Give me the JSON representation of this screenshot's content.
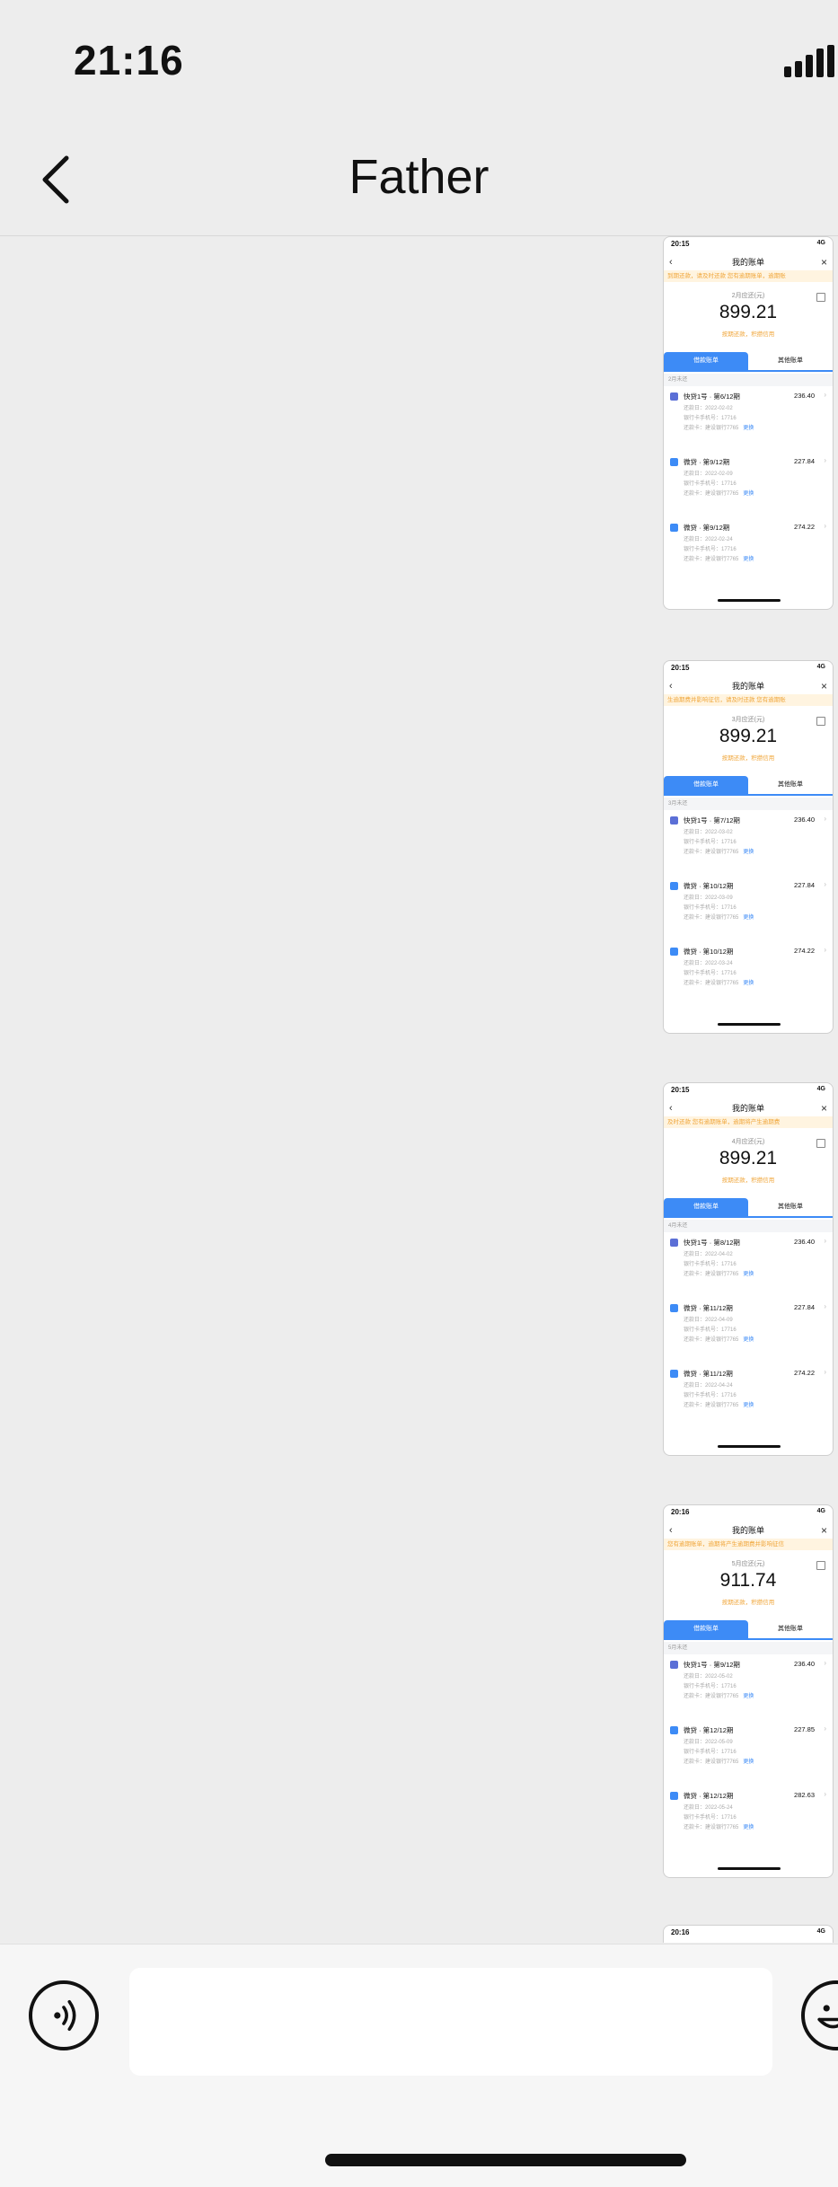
{
  "status_bar": {
    "time": "21:16"
  },
  "nav": {
    "title": "Father"
  },
  "screenshots": [
    {
      "time": "20:15",
      "net": "4G",
      "header": "我的账单",
      "banner": "到期还款，请及时还款     您有逾期账单，逾期账",
      "month": "2月应还(元)",
      "amount": "899.21",
      "hint": "按期还款，积攒信用",
      "tab_active": "借款账单",
      "tab_other": "其他账单",
      "section": "2月未还",
      "items": [
        {
          "name": "快贷1号 · 第6/12期",
          "amount": "236.40",
          "due": "还款日：2022-02-02",
          "bank": "银行卡手机号：17716",
          "card": "还款卡：建设银行7765",
          "link": "更换"
        },
        {
          "name": "微贷 · 第9/12期",
          "amount": "227.84",
          "due": "还款日：2022-02-09",
          "bank": "银行卡手机号：17716",
          "card": "还款卡：建设银行7765",
          "link": "更换"
        },
        {
          "name": "微贷 · 第9/12期",
          "amount": "274.22",
          "due": "还款日：2022-02-24",
          "bank": "银行卡手机号：17716",
          "card": "还款卡：建设银行7765",
          "link": "更换"
        }
      ]
    },
    {
      "time": "20:15",
      "net": "4G",
      "header": "我的账单",
      "banner": "生逾期费并影响征信，请及时还款     您有逾期账",
      "month": "3月应还(元)",
      "amount": "899.21",
      "hint": "按期还款，积攒信用",
      "tab_active": "借款账单",
      "tab_other": "其他账单",
      "section": "3月未还",
      "items": [
        {
          "name": "快贷1号 · 第7/12期",
          "amount": "236.40",
          "due": "还款日：2022-03-02",
          "bank": "银行卡手机号：17716",
          "card": "还款卡：建设银行7765",
          "link": "更换"
        },
        {
          "name": "微贷 · 第10/12期",
          "amount": "227.84",
          "due": "还款日：2022-03-09",
          "bank": "银行卡手机号：17716",
          "card": "还款卡：建设银行7765",
          "link": "更换"
        },
        {
          "name": "微贷 · 第10/12期",
          "amount": "274.22",
          "due": "还款日：2022-03-24",
          "bank": "银行卡手机号：17716",
          "card": "还款卡：建设银行7765",
          "link": "更换"
        }
      ]
    },
    {
      "time": "20:15",
      "net": "4G",
      "header": "我的账单",
      "banner": "及时还款     您有逾期账单，逾期将产生逾期费",
      "month": "4月应还(元)",
      "amount": "899.21",
      "hint": "按期还款，积攒信用",
      "tab_active": "借款账单",
      "tab_other": "其他账单",
      "section": "4月未还",
      "items": [
        {
          "name": "快贷1号 · 第8/12期",
          "amount": "236.40",
          "due": "还款日：2022-04-02",
          "bank": "银行卡手机号：17716",
          "card": "还款卡：建设银行7765",
          "link": "更换"
        },
        {
          "name": "微贷 · 第11/12期",
          "amount": "227.84",
          "due": "还款日：2022-04-09",
          "bank": "银行卡手机号：17716",
          "card": "还款卡：建设银行7765",
          "link": "更换"
        },
        {
          "name": "微贷 · 第11/12期",
          "amount": "274.22",
          "due": "还款日：2022-04-24",
          "bank": "银行卡手机号：17716",
          "card": "还款卡：建设银行7765",
          "link": "更换"
        }
      ]
    },
    {
      "time": "20:16",
      "net": "4G",
      "header": "我的账单",
      "banner": "您有逾期账单，逾期将产生逾期费并影响征信",
      "month": "5月应还(元)",
      "amount": "911.74",
      "hint": "按期还款，积攒信用",
      "tab_active": "借款账单",
      "tab_other": "其他账单",
      "section": "5月未还",
      "items": [
        {
          "name": "快贷1号 · 第9/12期",
          "amount": "236.40",
          "due": "还款日：2022-05-02",
          "bank": "银行卡手机号：17716",
          "card": "还款卡：建设银行7765",
          "link": "更换"
        },
        {
          "name": "微贷 · 第12/12期",
          "amount": "227.85",
          "due": "还款日：2022-05-09",
          "bank": "银行卡手机号：17716",
          "card": "还款卡：建设银行7765",
          "link": "更换"
        },
        {
          "name": "微贷 · 第12/12期",
          "amount": "282.63",
          "due": "还款日：2022-05-24",
          "bank": "银行卡手机号：17716",
          "card": "还款卡：建设银行7765",
          "link": "更换"
        }
      ]
    }
  ],
  "partial_screenshot": {
    "time": "20:16",
    "net": "4G"
  },
  "icons": {
    "back": "chevron-left-icon",
    "voice": "voice-icon",
    "emoji": "emoji-icon",
    "signal": "signal-icon"
  }
}
